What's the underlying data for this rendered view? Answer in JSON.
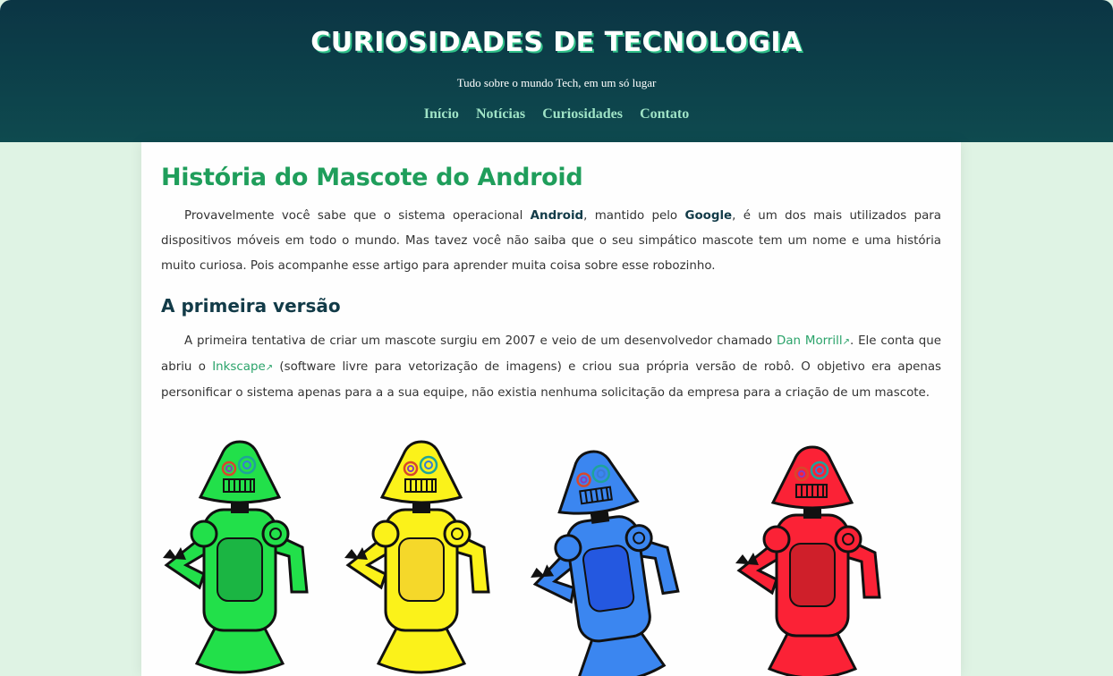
{
  "header": {
    "title": "CURIOSIDADES DE TECNOLOGIA",
    "tagline": "Tudo sobre o mundo Tech, em um só lugar",
    "nav": [
      {
        "label": "Início"
      },
      {
        "label": "Notícias"
      },
      {
        "label": "Curiosidades"
      },
      {
        "label": "Contato"
      }
    ]
  },
  "article": {
    "title": "História do Mascote do Android",
    "intro": {
      "t1": "Provavelmente você sabe que o sistema operacional ",
      "b1": "Android",
      "t2": ", mantido pelo ",
      "b2": "Google",
      "t3": ", é um dos mais utilizados para dispositivos móveis em todo o mundo. Mas tavez você não saiba que o seu simpático mascote tem um nome e uma história muito curiosa. Pois acompanhe esse artigo para aprender muita coisa sobre esse robozinho."
    },
    "section1": {
      "heading": "A primeira versão",
      "t1": "A primeira tentativa de criar um mascote surgiu em 2007 e veio de um desenvolvedor chamado ",
      "link1": "Dan Morrill",
      "t2": ". Ele conta que abriu o ",
      "link2": "Inkscape",
      "t3": " (software livre para vetorização de imagens) e criou sua própria versão de robô. O objetivo era apenas personificar o sistema apenas para a a sua equipe, não existia nenhuma solicitação da empresa para a criação de um mascote.",
      "external_link_symbol": "↗"
    },
    "robots": [
      {
        "color": "green",
        "body": "#22e04a",
        "panel": "#1bb543"
      },
      {
        "color": "yellow",
        "body": "#fbf21a",
        "panel": "#f5d82a"
      },
      {
        "color": "blue",
        "body": "#3b86f0",
        "panel": "#2458e0"
      },
      {
        "color": "red",
        "body": "#fb2236",
        "panel": "#cf1f2a"
      }
    ]
  }
}
